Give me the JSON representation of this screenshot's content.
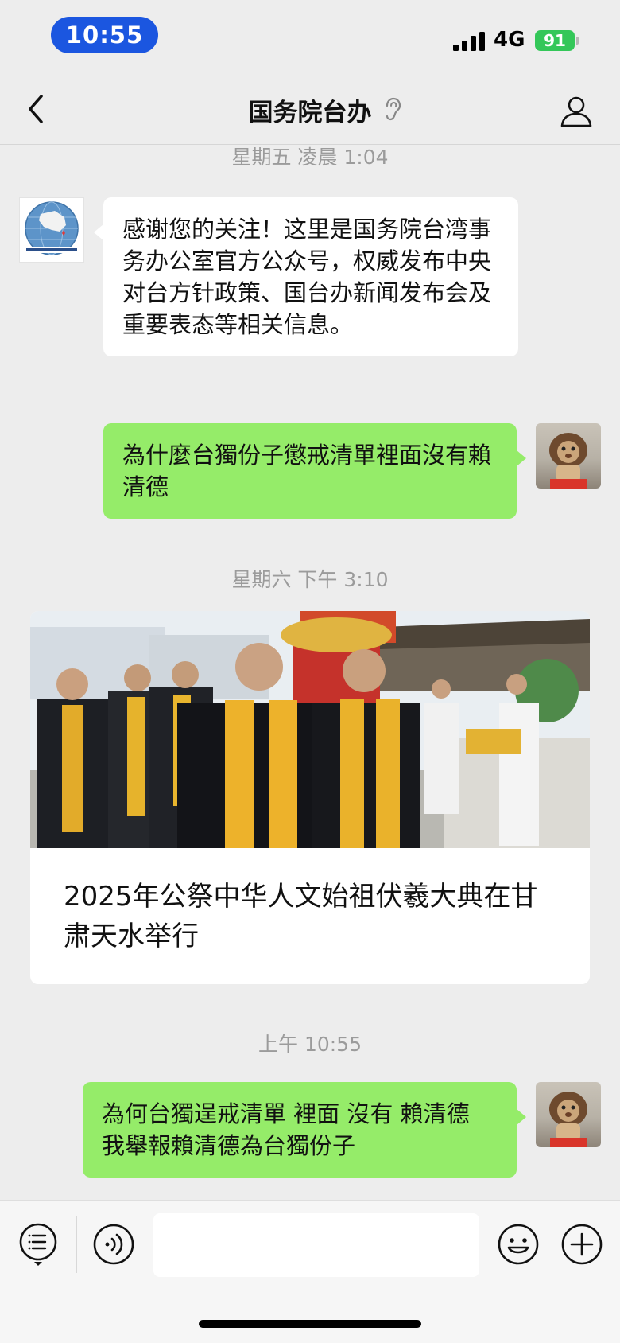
{
  "status_bar": {
    "time": "10:55",
    "network": "4G",
    "battery": "91"
  },
  "nav": {
    "title": "国务院台办"
  },
  "messages": {
    "ts1": "星期五 凌晨 1:04",
    "welcome": "感谢您的关注！这里是国务院台湾事务办公室官方公众号，权威发布中央对台方针政策、国台办新闻发布会及重要表态等相关信息。",
    "user_msg1": "為什麼台獨份子懲戒清單裡面沒有賴清德",
    "ts2": "星期六 下午 3:10",
    "article_title": "2025年公祭中华人文始祖伏羲大典在甘肃天水举行",
    "ts3": "上午 10:55",
    "user_msg2": "為何台獨逞戒清單 裡面 沒有 賴清德 我舉報賴清德為台獨份子"
  },
  "input": {
    "placeholder": ""
  },
  "icons": {
    "back": "chevron-left-icon",
    "ear": "ear-icon",
    "profile": "person-icon",
    "menu": "list-menu-icon",
    "voice": "voice-icon",
    "emoji": "emoji-icon",
    "plus": "plus-icon"
  },
  "colors": {
    "background": "#ededed",
    "green_bubble": "#95ec69",
    "time_pill": "#1b56e0",
    "battery": "#34c759"
  }
}
